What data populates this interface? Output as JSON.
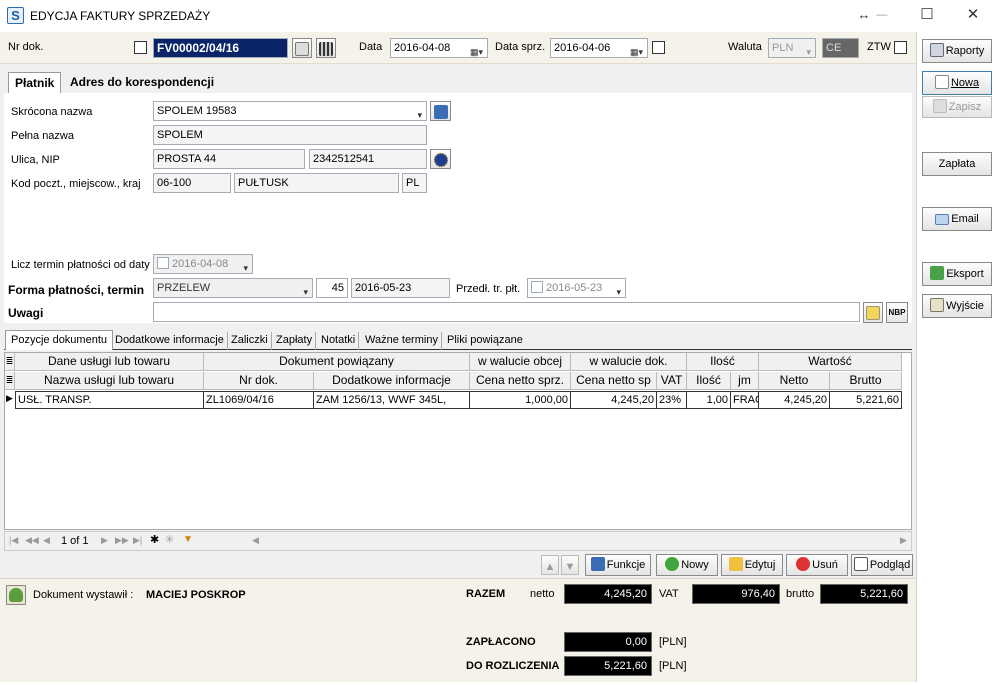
{
  "window": {
    "title": "EDYCJA FAKTURY SPRZEDAŻY",
    "resize_glyph": "↔",
    "min_glyph": "—",
    "max_glyph": "☐",
    "close_glyph": "✕"
  },
  "header": {
    "nr_label": "Nr dok.",
    "nr_value": "FV00002/04/16",
    "data_label": "Data",
    "data_value": "2016-04-08",
    "data_sprz_label": "Data sprz.",
    "data_sprz_value": "2016-04-06",
    "waluta_label": "Waluta",
    "waluta_value": "PLN",
    "ce_value": "CE",
    "ztw_label": "ZTW"
  },
  "tabs": [
    "Płatnik",
    "Adres do korespondencji"
  ],
  "form": {
    "skrocona_label": "Skrócona nazwa",
    "skrocona_value": "SPOLEM 19583",
    "pelna_label": "Pełna nazwa",
    "pelna_value": "SPOLEM",
    "ulica_label": "Ulica, NIP",
    "ulica_value": "PROSTA 44",
    "nip_value": "2342512541",
    "kod_label": "Kod poczt., miejscow., kraj",
    "kod_value": "06-100",
    "miejscowosc_value": "PUŁTUSK",
    "kraj_value": "PL",
    "licz_label": "Licz termin płatności od daty",
    "licz_value": "2016-04-08",
    "forma_label": "Forma płatności, termin",
    "forma_value": "PRZELEW",
    "dni_value": "45",
    "termin_value": "2016-05-23",
    "predl_label": "Przedł. tr. płt.",
    "predl_value": "2016-05-23",
    "uwagi_label": "Uwagi",
    "uwagi_value": "",
    "nbp_label": "NBP"
  },
  "subtabs": [
    "Pozycje dokumentu",
    "Dodatkowe informacje",
    "Zaliczki",
    "Zapłaty",
    "Notatki",
    "Ważne terminy",
    "Pliki powiązane"
  ],
  "grid": {
    "group_headers": [
      "Dane usługi lub towaru",
      "Dokument powiązany",
      "w walucie obcej",
      "w walucie dok.",
      "Ilość",
      "Wartość"
    ],
    "col_headers": [
      "Nazwa usługi lub towaru",
      "Nr dok.",
      "Dodatkowe informacje",
      "Cena netto sprz.",
      "Cena netto sp",
      "VAT",
      "Ilość",
      "jm",
      "Netto",
      "Brutto"
    ],
    "rows": [
      [
        "USŁ. TRANSP.",
        "ZL1069/04/16",
        "ZAM 1256/13, WWF 345L,",
        "1,000,00",
        "4,245,20",
        "23%",
        "1,00",
        "FRAC",
        "4,245,20",
        "5,221,60"
      ]
    ]
  },
  "pager": {
    "text": "1 of 1"
  },
  "actions": {
    "funkcje": "Funkcje",
    "nowy": "Nowy",
    "edytuj": "Edytuj",
    "usun": "Usuń",
    "podglad": "Podgląd"
  },
  "footer": {
    "wystawil_label": "Dokument wystawił :",
    "wystawil_value": "MACIEJ POSKROP",
    "razem_label": "RAZEM",
    "netto_label": "netto",
    "netto_value": "4,245,20",
    "vat_label": "VAT",
    "vat_value": "976,40",
    "brutto_label": "brutto",
    "brutto_value": "5,221,60",
    "zaplacono_label": "ZAPŁACONO",
    "zaplacono_value": "0,00",
    "zaplacono_cur": "[PLN]",
    "rozliczenia_label": "DO ROZLICZENIA",
    "rozliczenia_value": "5,221,60",
    "rozliczenia_cur": "[PLN]"
  },
  "sidebar": {
    "raporty": "Raporty",
    "nowa": "Nowa",
    "zapisz": "Zapisz",
    "zaplata": "Zapłata",
    "email": "Email",
    "eksport": "Eksport",
    "wyjscie": "Wyjście"
  }
}
